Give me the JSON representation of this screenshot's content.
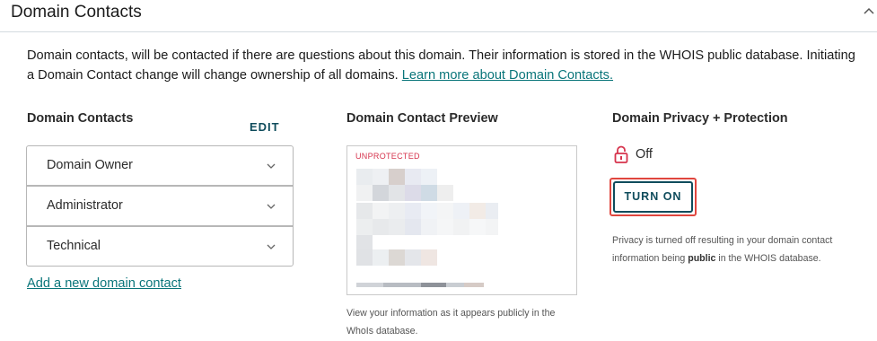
{
  "section": {
    "title": "Domain Contacts"
  },
  "description": {
    "text": "Domain contacts, will be contacted if there are questions about this domain. Their information is stored in the WHOIS public database. Initiating a Domain Contact change will change ownership of all domains. ",
    "link": "Learn more about Domain Contacts."
  },
  "contacts": {
    "heading": "Domain Contacts",
    "edit_label": "EDIT",
    "items": [
      "Domain Owner",
      "Administrator",
      "Technical"
    ],
    "add_link": "Add a new domain contact"
  },
  "preview": {
    "heading": "Domain Contact Preview",
    "status": "UNPROTECTED",
    "caption_line1": "View your information as it appears publicly in the",
    "caption_line2": "WhoIs database."
  },
  "privacy": {
    "heading": "Domain Privacy + Protection",
    "status": "Off",
    "button_label": "TURN ON",
    "note_line1": "Privacy is turned off resulting in your domain contact",
    "note_pre": "information being ",
    "note_bold": "public",
    "note_post": " in the WHOIS database."
  },
  "colors": {
    "accent": "#09757a",
    "button": "#0f4c5c",
    "warning": "#d6334c",
    "highlight": "#e0463e"
  }
}
